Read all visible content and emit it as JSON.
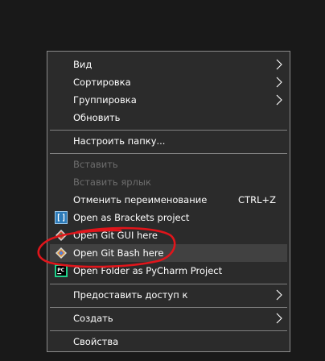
{
  "menu": {
    "items": [
      {
        "label": "Вид"
      },
      {
        "label": "Сортировка"
      },
      {
        "label": "Группировка"
      },
      {
        "label": "Обновить"
      },
      {
        "label": "Настроить папку..."
      },
      {
        "label": "Вставить"
      },
      {
        "label": "Вставить ярлык"
      },
      {
        "label": "Отменить переименование",
        "shortcut": "CTRL+Z"
      },
      {
        "label": "Open as Brackets project",
        "icon": "brackets-icon"
      },
      {
        "label": "Open Git GUI here",
        "icon": "git-gui-icon"
      },
      {
        "label": "Open Git Bash here",
        "icon": "git-bash-icon"
      },
      {
        "label": "Open Folder as PyCharm Project",
        "icon": "pycharm-icon"
      },
      {
        "label": "Предоставить доступ к"
      },
      {
        "label": "Создать"
      },
      {
        "label": "Свойства"
      }
    ]
  },
  "colors": {
    "background": "#191919",
    "menu_bg": "#2b2b2b",
    "hover_bg": "#414141",
    "disabled_text": "#6d6d6d",
    "annotation_red": "#e0151b"
  }
}
